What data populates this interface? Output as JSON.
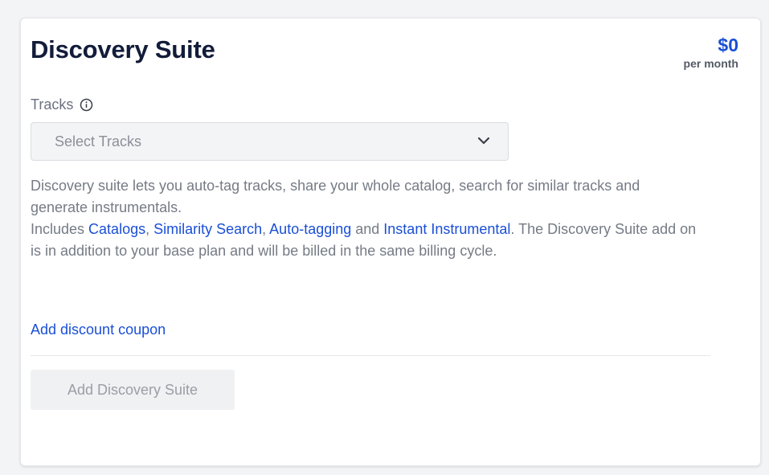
{
  "card": {
    "title": "Discovery Suite",
    "price": "$0",
    "price_period": "per month"
  },
  "tracks_field": {
    "label": "Tracks",
    "info_icon": "info-circle-icon",
    "placeholder": "Select Tracks",
    "dropdown_icon": "chevron-down-icon"
  },
  "description": {
    "line1": "Discovery suite lets you auto-tag tracks, share your whole catalog, search for similar tracks and generate instrumentals.",
    "includes_prefix": "Includes ",
    "link_catalogs": "Catalogs",
    "sep1": ", ",
    "link_similarity": "Similarity Search",
    "sep2": ", ",
    "link_autotagging": "Auto-tagging",
    "sep3": " and ",
    "link_instrumental": "Instant Instrumental",
    "suffix": ". The Discovery Suite add on is in addition to your base plan and will be billed in the same billing cycle."
  },
  "coupon_link": "Add discount coupon",
  "submit_button": {
    "label": "Add Discovery Suite",
    "disabled": true
  },
  "colors": {
    "accent": "#1a4fd6",
    "title": "#121c3a",
    "muted_text": "#757b85"
  }
}
